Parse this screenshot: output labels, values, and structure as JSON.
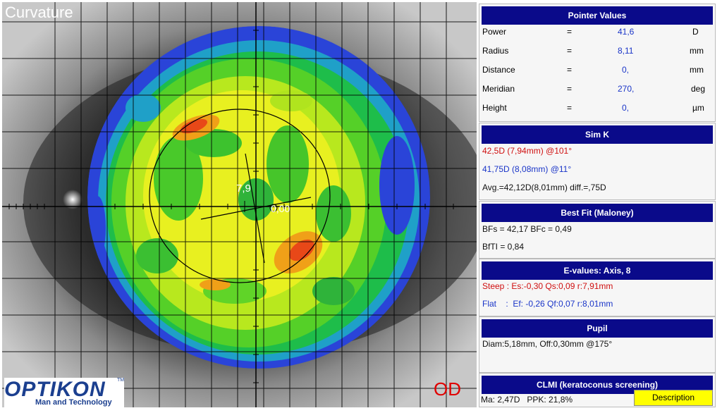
{
  "map": {
    "title": "Curvature",
    "eye": "OD",
    "center_labels": [
      "7,9",
      "0,00"
    ],
    "logo_text": "OPTIKON",
    "logo_sub": "Man and Technology",
    "logo_tm": "TM"
  },
  "pointer_values": {
    "title": "Pointer Values",
    "rows": [
      {
        "label": "Power",
        "eq": "=",
        "value": "41,6",
        "unit": "D"
      },
      {
        "label": "Radius",
        "eq": "=",
        "value": "8,11",
        "unit": "mm"
      },
      {
        "label": "Distance",
        "eq": "=",
        "value": "0,",
        "unit": "mm"
      },
      {
        "label": "Meridian",
        "eq": "=",
        "value": "270,",
        "unit": "deg"
      },
      {
        "label": "Height",
        "eq": "=",
        "value": "0,",
        "unit": "µm"
      }
    ]
  },
  "sim_k": {
    "title": "Sim K",
    "steep": "42,5D (7,94mm) @101°",
    "flat": "41,75D (8,08mm) @11°",
    "avg": "Avg.=42,12D(8,01mm) diff.=,75D"
  },
  "best_fit": {
    "title": "Best Fit (Maloney)",
    "line1": "BFs = 42,17 BFc = 0,49",
    "line2": "BfTI = 0,84"
  },
  "e_values": {
    "title": "E-values: Axis, 8",
    "steep": "Steep :  Es:-0,30 Qs:0,09 r:7,91mm",
    "flat": "Flat    :  Ef: -0,26 Qf:0,07 r:8,01mm"
  },
  "pupil": {
    "title": "Pupil",
    "line": "Diam:5,18mm, Off:0,30mm @175°"
  },
  "clmi": {
    "title": "CLMI (keratoconus screening)",
    "line": "Ma: 2,47D   PPK: 21,8%",
    "button": "Description"
  },
  "colors": {
    "header_bg": "#0a0a8a",
    "steep_text": "#d01010",
    "flat_text": "#1a35c8",
    "button_bg": "#ffff00",
    "od_text": "#e00000"
  }
}
